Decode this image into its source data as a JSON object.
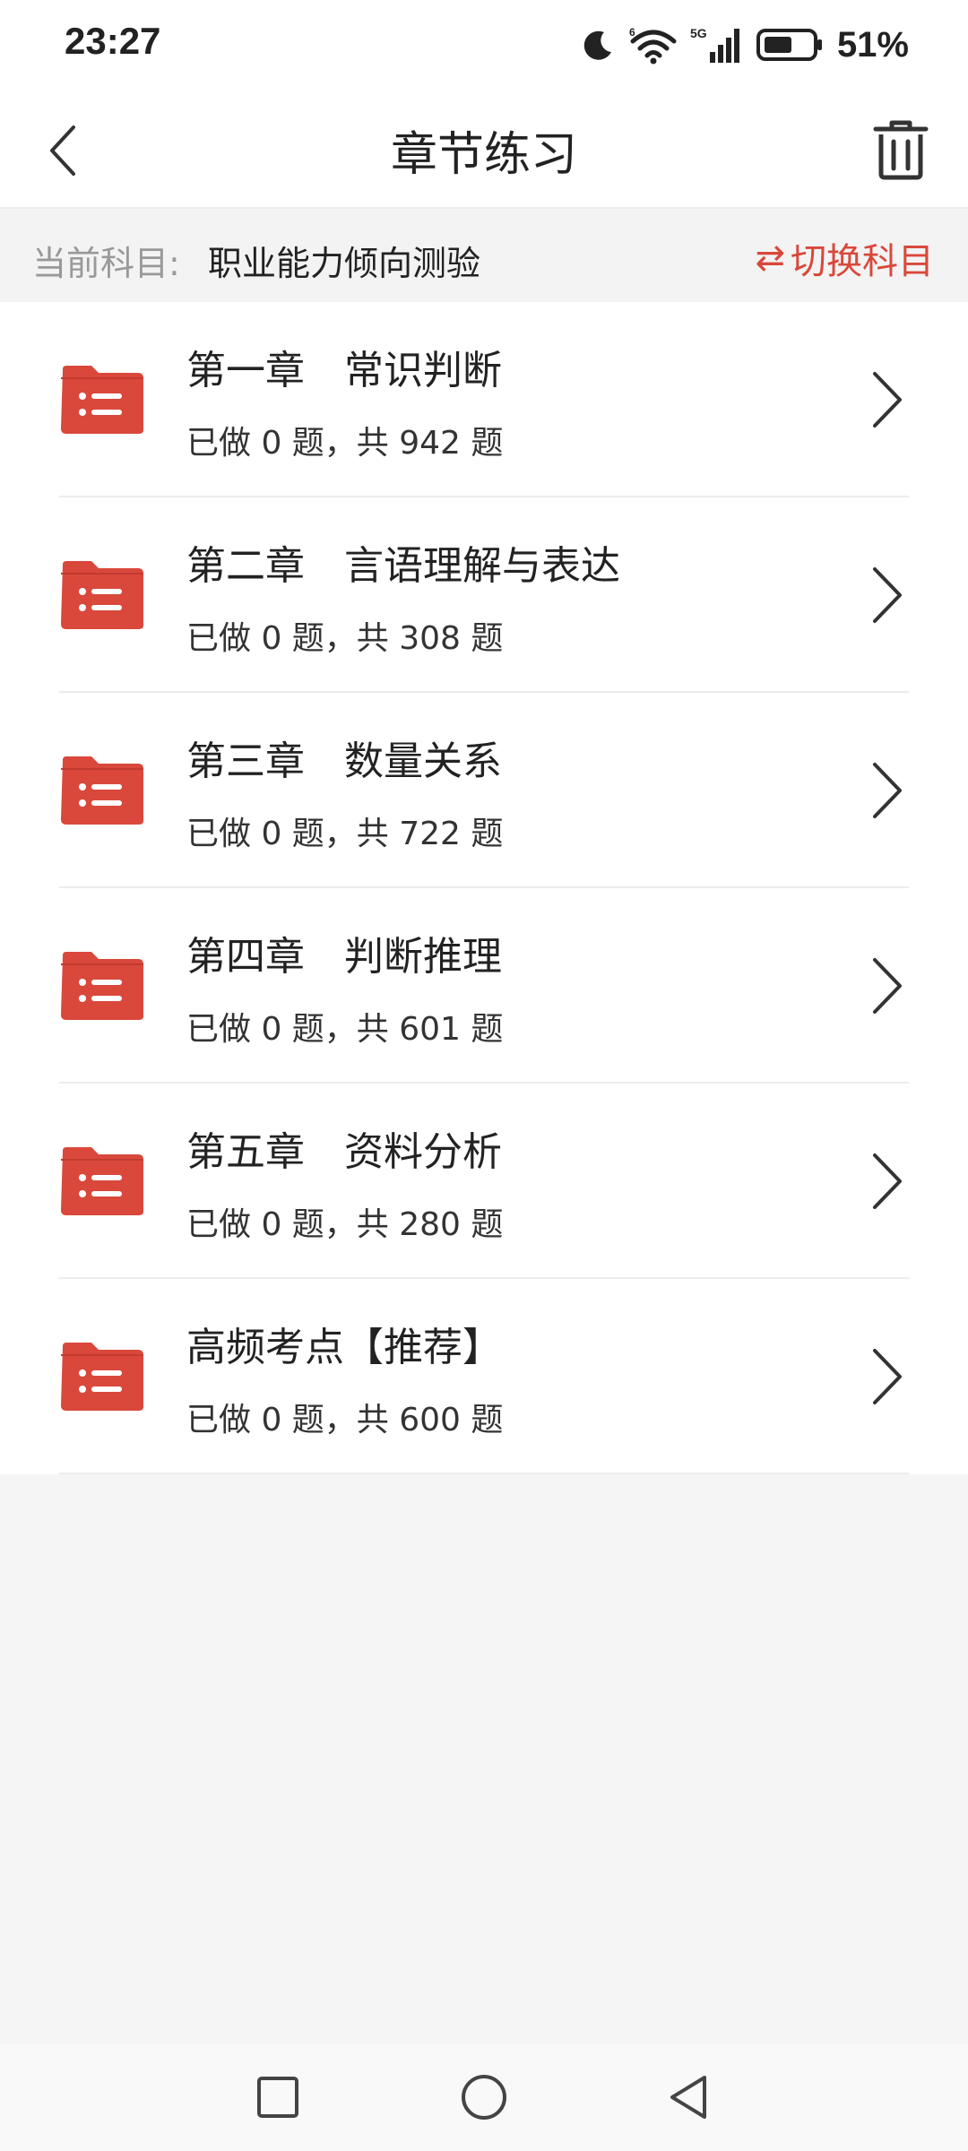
{
  "status_bar": {
    "time": "23:27",
    "battery_percent": "51%",
    "network": "5G",
    "wifi_badge": "6"
  },
  "nav": {
    "title": "章节练习"
  },
  "subject": {
    "label": "当前科目:",
    "value": "职业能力倾向测验",
    "switch_label": "切换科目",
    "switch_icon": "⇄"
  },
  "chapters": [
    {
      "title": "第一章　常识判断",
      "progress": "已做 0 题，共 942 题"
    },
    {
      "title": "第二章　言语理解与表达",
      "progress": "已做 0 题，共 308 题"
    },
    {
      "title": "第三章　数量关系",
      "progress": "已做 0 题，共 722 题"
    },
    {
      "title": "第四章　判断推理",
      "progress": "已做 0 题，共 601 题"
    },
    {
      "title": "第五章　资料分析",
      "progress": "已做 0 题，共 280 题"
    },
    {
      "title": "高频考点【推荐】",
      "progress": "已做 0 题，共 600 题"
    }
  ],
  "colors": {
    "accent": "#d9483b",
    "folder": "#d9483b"
  }
}
